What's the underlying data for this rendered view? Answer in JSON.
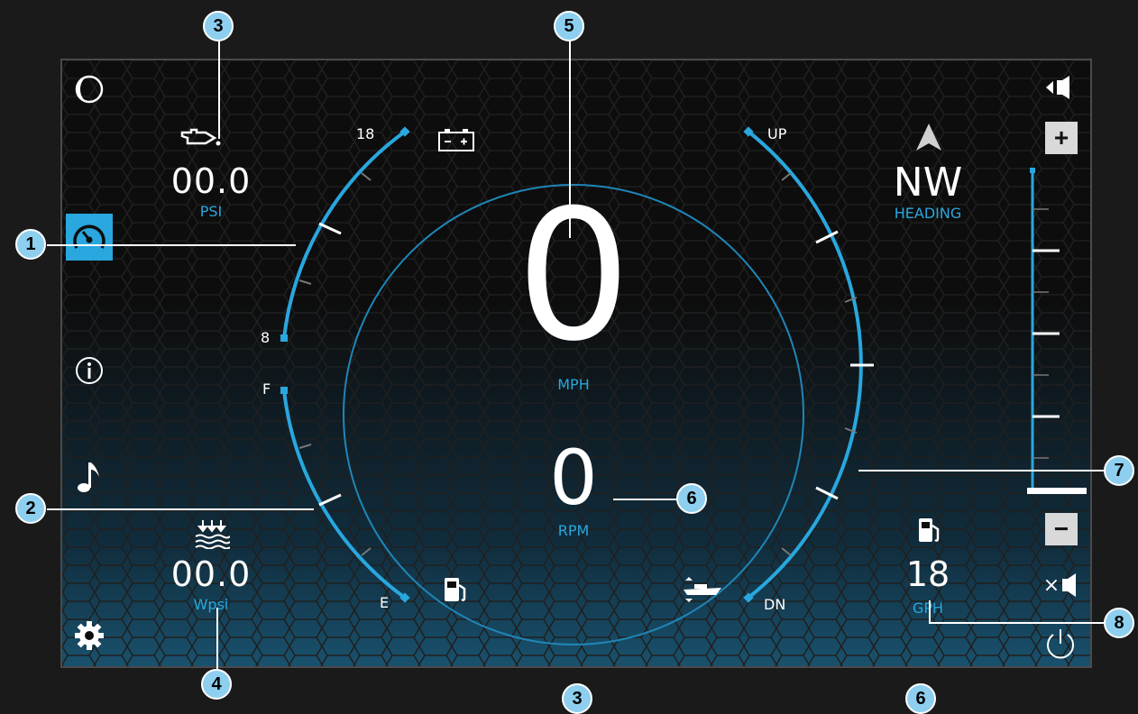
{
  "gauges": {
    "speed_value": "0",
    "speed_unit": "MPH",
    "rpm_value": "0",
    "rpm_unit": "RPM",
    "left_upper_arc": {
      "max_label": "18",
      "min_label": "8"
    },
    "fuel_arc": {
      "full_label": "F",
      "empty_label": "E"
    },
    "trim_arc": {
      "up_label": "UP",
      "down_label": "DN"
    }
  },
  "oil_pressure": {
    "value": "00.0",
    "unit": "PSI"
  },
  "water_pressure": {
    "value": "00.0",
    "unit": "Wpsi"
  },
  "heading": {
    "value": "NW",
    "label": "HEADING"
  },
  "fuel_rate": {
    "value": "18",
    "unit": "GPH"
  },
  "sidebar": {
    "items": [
      {
        "icon": "moon-icon"
      },
      {
        "icon": "speedometer-icon",
        "active": true
      },
      {
        "icon": "info-icon"
      },
      {
        "icon": "music-note-icon"
      },
      {
        "icon": "gear-icon"
      }
    ]
  },
  "volume": {
    "plus_label": "+",
    "minus_label": "−",
    "mute_label": "×",
    "level": 0.0
  },
  "callouts": [
    "1",
    "2",
    "3",
    "4",
    "5",
    "6",
    "7",
    "8",
    "3",
    "6"
  ],
  "colors": {
    "accent": "#29a7de",
    "active_bg": "#29a7de",
    "callout": "#8ecff0"
  }
}
